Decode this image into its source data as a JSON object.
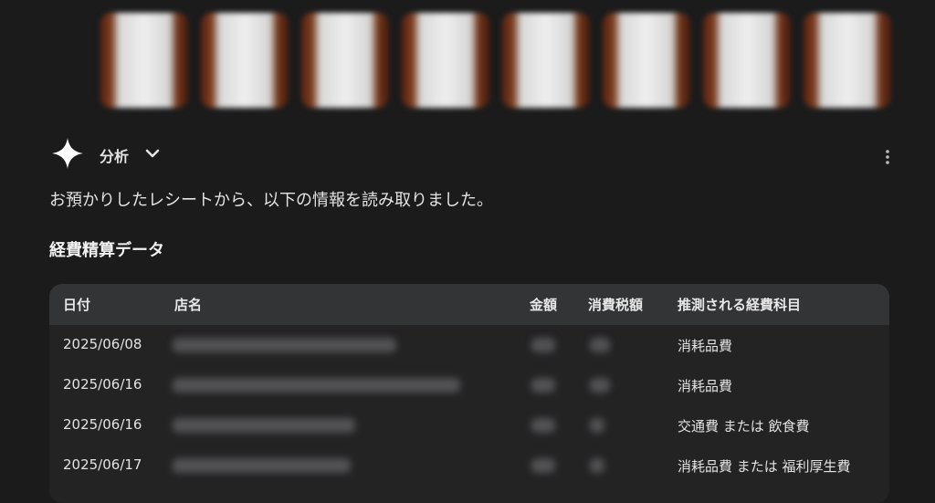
{
  "header": {
    "section_label": "分析",
    "icons": [
      "sparkle-icon",
      "chevron-down-icon",
      "more-vert-icon"
    ]
  },
  "intro_text": "お預かりしたレシートから、以下の情報を読み取りました。",
  "section_title": "経費精算データ",
  "table": {
    "columns": [
      "日付",
      "店名",
      "金額",
      "消費税額",
      "推測される経費科目"
    ],
    "rows": [
      {
        "date": "2025/06/08",
        "category": "消耗品費"
      },
      {
        "date": "2025/06/16",
        "category": "消耗品費"
      },
      {
        "date": "2025/06/16",
        "category": "交通費 または 飲食費"
      },
      {
        "date": "2025/06/17",
        "category": "消耗品費 または 福利厚生費"
      }
    ]
  },
  "colors": {
    "background": "#1b1b1c",
    "table_header": "#333436",
    "table_body": "#232324",
    "text": "#e3e3e3"
  }
}
